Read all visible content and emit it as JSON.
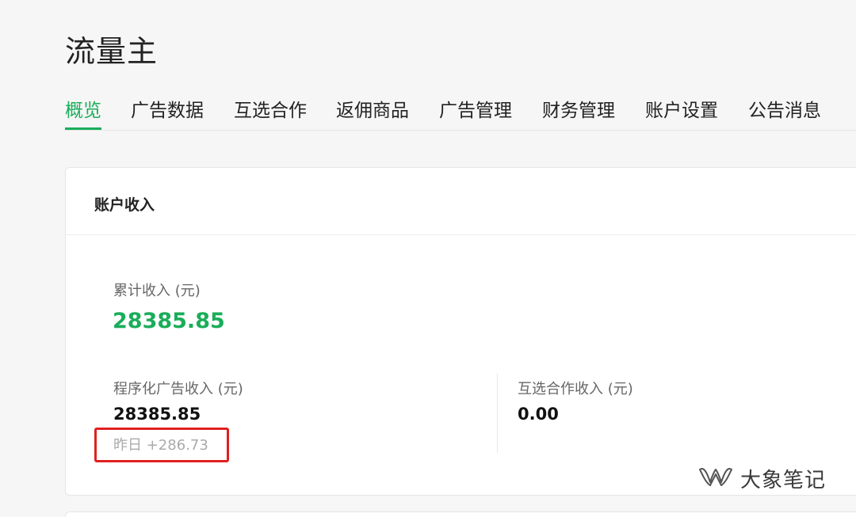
{
  "app": {
    "title": "流量主"
  },
  "tabs": [
    {
      "label": "概览",
      "active": true
    },
    {
      "label": "广告数据"
    },
    {
      "label": "互选合作"
    },
    {
      "label": "返佣商品"
    },
    {
      "label": "广告管理"
    },
    {
      "label": "财务管理"
    },
    {
      "label": "账户设置"
    },
    {
      "label": "公告消息"
    }
  ],
  "income_card": {
    "title": "账户收入",
    "total": {
      "label": "累计收入 (元)",
      "value": "28385.85"
    },
    "programmatic": {
      "label": "程序化广告收入 (元)",
      "value": "28385.85",
      "yesterday_label": "昨日 +286.73"
    },
    "mutual": {
      "label": "互选合作收入 (元)",
      "value": "0.00"
    }
  },
  "watermark": {
    "text": "大象笔记",
    "icon": "wechat-channel-icon"
  },
  "colors": {
    "accent": "#1aad5a",
    "highlight": "#e02020"
  }
}
